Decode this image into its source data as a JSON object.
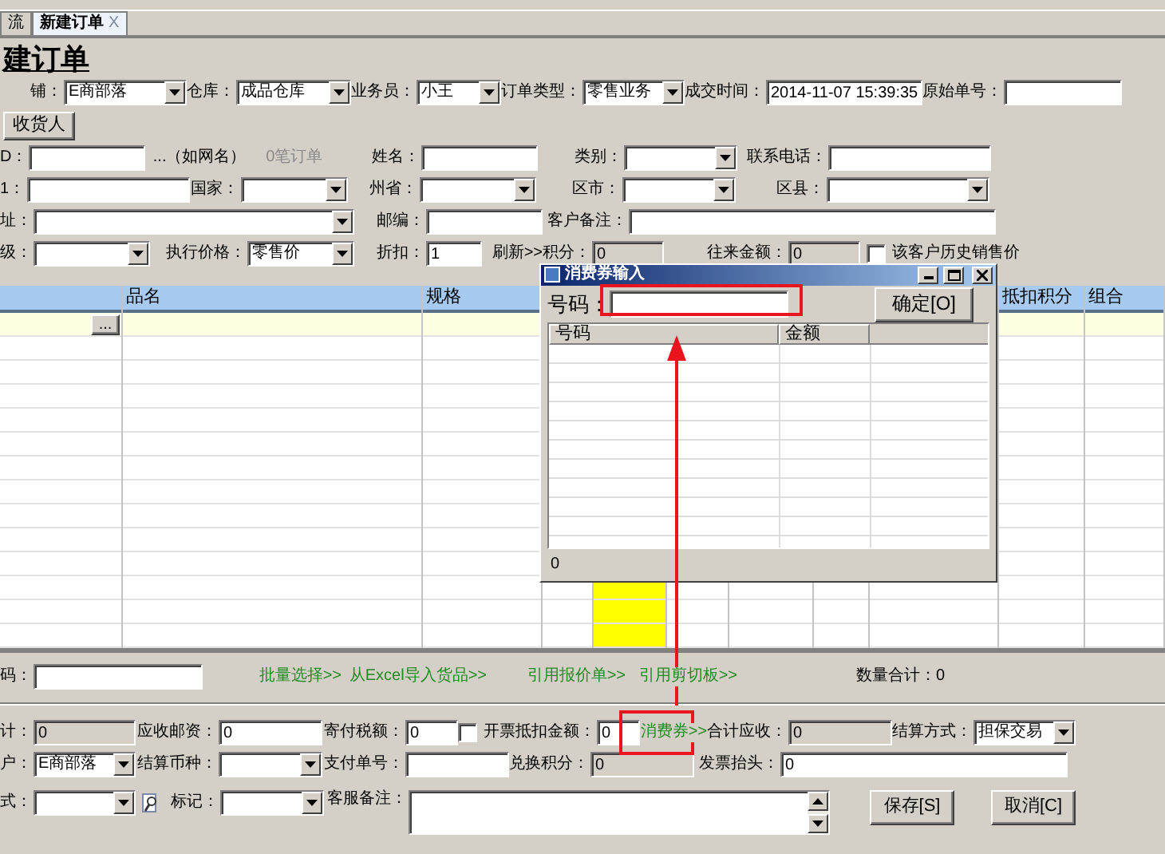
{
  "tabs": [
    {
      "label": "流",
      "selected": false
    },
    {
      "label": "新建订单",
      "selected": true,
      "close": "X"
    }
  ],
  "page_title": "建订单",
  "order_fields": [
    {
      "kind": "select",
      "label": "铺：",
      "value": "E商部落"
    },
    {
      "kind": "select",
      "label": "仓库：",
      "value": "成品仓库"
    },
    {
      "kind": "select",
      "label": "业务员：",
      "value": "小王"
    },
    {
      "kind": "select",
      "label": "订单类型：",
      "value": "零售业务"
    },
    {
      "kind": "input",
      "label": "成交时间：",
      "value": "2014-11-07 15:39:35"
    },
    {
      "kind": "input",
      "label": "原始单号："
    }
  ],
  "receiver_button": "收货人",
  "customer_rows": [
    [
      {
        "kind": "input",
        "label": "D："
      },
      {
        "kind": "note",
        "text": "...（如网名）"
      },
      {
        "kind": "muted",
        "text": "0笔订单"
      },
      {
        "kind": "input",
        "label": "姓名："
      },
      {
        "kind": "select",
        "label": "类别："
      },
      {
        "kind": "input",
        "label": "联系电话："
      }
    ],
    [
      {
        "kind": "input",
        "label": "1："
      },
      {
        "kind": "select",
        "label": "国家："
      },
      {
        "kind": "select",
        "label": "州省："
      },
      {
        "kind": "select",
        "label": "区市："
      },
      {
        "kind": "select",
        "label": "区县："
      }
    ],
    [
      {
        "kind": "select",
        "label": "址："
      },
      {
        "kind": "input",
        "label": "邮编："
      },
      {
        "kind": "input",
        "label": "客户备注："
      }
    ],
    [
      {
        "kind": "select",
        "label": "级："
      },
      {
        "kind": "select",
        "label": "执行价格：",
        "value": "零售价"
      },
      {
        "kind": "input",
        "label": "折扣：",
        "value": "1"
      },
      {
        "kind": "note",
        "text": "刷新>>"
      },
      {
        "kind": "readonly",
        "label": "积分：",
        "value": "0"
      },
      {
        "kind": "readonly",
        "label": "往来金额：",
        "value": "0"
      },
      {
        "kind": "checkbox",
        "label": "该客户历史销售价",
        "checked": false
      }
    ]
  ],
  "grid": {
    "row_button": "...",
    "columns": [
      {
        "highlighted": false
      },
      {
        "label": "品名",
        "highlighted": false
      },
      {
        "label": "规格",
        "highlighted": false
      },
      {
        "highlighted": false
      },
      {
        "highlighted": true
      },
      {
        "highlighted": false
      },
      {
        "highlighted": false
      },
      {
        "highlighted": false
      },
      {
        "highlighted": false
      },
      {
        "label": "抵扣积分",
        "highlighted": false
      },
      {
        "label": "组合",
        "highlighted": false
      }
    ]
  },
  "grid_toolbar": [
    {
      "kind": "input",
      "label": "码："
    },
    {
      "kind": "link",
      "text": "批量选择>>"
    },
    {
      "kind": "link",
      "text": "从Excel导入货品>>"
    },
    {
      "kind": "link",
      "text": "引用报价单>>"
    },
    {
      "kind": "link",
      "text": "引用剪切板>>"
    },
    {
      "kind": "text",
      "text": "数量合计：0"
    }
  ],
  "totals_rows": [
    [
      {
        "kind": "readonly",
        "label": "计：",
        "value": "0"
      },
      {
        "kind": "input",
        "label": "应收邮资：",
        "value": "0"
      },
      {
        "kind": "input",
        "label": "寄付税额：",
        "value": "0"
      },
      {
        "kind": "checkbox",
        "label": "开票",
        "checked": false
      },
      {
        "kind": "input",
        "label": "抵扣金额：",
        "value": "0"
      },
      {
        "kind": "link",
        "text": "消费券>>"
      },
      {
        "kind": "readonly",
        "label": "合计应收：",
        "value": "0"
      },
      {
        "kind": "select",
        "label": "结算方式：",
        "value": "担保交易"
      }
    ],
    [
      {
        "kind": "select",
        "label": "户：",
        "value": "E商部落"
      },
      {
        "kind": "select",
        "label": "结算币种："
      },
      {
        "kind": "input",
        "label": "支付单号："
      },
      {
        "kind": "readonly",
        "label": "兑换积分：",
        "value": "0"
      },
      {
        "kind": "input",
        "label": "发票抬头：",
        "value": "0"
      }
    ],
    [
      {
        "kind": "select",
        "label": "式：",
        "lookup": true
      },
      {
        "kind": "select",
        "label": "标记："
      },
      {
        "kind": "textarea",
        "label": "客服备注："
      },
      {
        "kind": "button",
        "text": "保存[S]"
      },
      {
        "kind": "button",
        "text": "取消[C]"
      }
    ]
  ],
  "dialog": {
    "title": "消费券输入",
    "code_label": "号码：",
    "ok_button": "确定[O]",
    "columns": [
      "号码",
      "金额"
    ],
    "footer": "0"
  }
}
